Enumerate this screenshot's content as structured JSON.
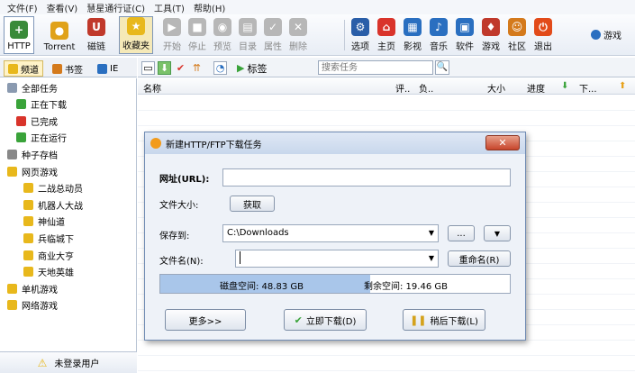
{
  "menu": [
    "文件(F)",
    "查看(V)",
    "慧星通行证(C)",
    "工具(T)",
    "帮助(H)"
  ],
  "toolbar": {
    "left": [
      {
        "label": "HTTP",
        "icon": "http-add-icon",
        "color": "#3a8a3a"
      },
      {
        "label": "Torrent",
        "icon": "torrent-icon",
        "color": "#e0a21a"
      },
      {
        "label": "磁链",
        "icon": "magnet-icon",
        "color": "#c0392b"
      },
      {
        "label": "收藏夹",
        "icon": "star-icon",
        "color": "#e8b81c"
      }
    ],
    "disabled": [
      {
        "label": "开始",
        "icon": "start-icon"
      },
      {
        "label": "停止",
        "icon": "stop-icon"
      },
      {
        "label": "预览",
        "icon": "preview-icon"
      },
      {
        "label": "目录",
        "icon": "folder-icon"
      },
      {
        "label": "属性",
        "icon": "properties-icon"
      },
      {
        "label": "删除",
        "icon": "delete-icon"
      }
    ],
    "right": [
      {
        "label": "选项",
        "icon": "options-icon",
        "color": "#2a5ea8"
      },
      {
        "label": "主页",
        "icon": "home-icon",
        "color": "#d9342b"
      },
      {
        "label": "影视",
        "icon": "video-icon",
        "color": "#2a6fc0"
      },
      {
        "label": "音乐",
        "icon": "music-icon",
        "color": "#2a6fc0"
      },
      {
        "label": "软件",
        "icon": "software-icon",
        "color": "#2a6fc0"
      },
      {
        "label": "游戏",
        "icon": "game-icon",
        "color": "#c0392b"
      },
      {
        "label": "社区",
        "icon": "community-icon",
        "color": "#d47a1c"
      },
      {
        "label": "退出",
        "icon": "exit-icon",
        "color": "#e24b1a"
      }
    ],
    "overflow": "游戏"
  },
  "tabs": [
    {
      "label": "频道",
      "icon": "channel-star-icon",
      "color": "#e8b81c"
    },
    {
      "label": "书签",
      "icon": "bookmark-icon",
      "color": "#d47a1c"
    },
    {
      "label": "IE",
      "icon": "ie-icon",
      "color": "#2a6fc0"
    }
  ],
  "subbar": {
    "tag_label": "标签",
    "search_placeholder": "搜索任务"
  },
  "tree": [
    {
      "label": "全部任务",
      "icon": "all-tasks-icon",
      "color": "#8a9ab0"
    },
    {
      "label": "正在下载",
      "icon": "downloading-icon",
      "color": "#3aa33a"
    },
    {
      "label": "已完成",
      "icon": "completed-icon",
      "color": "#d9342b"
    },
    {
      "label": "正在运行",
      "icon": "running-icon",
      "color": "#3aa33a"
    },
    {
      "label": "种子存档",
      "icon": "torrent-archive-icon",
      "color": "#888"
    },
    {
      "label": "网页游戏",
      "icon": "webgame-folder-icon",
      "color": "#e8b81c"
    },
    {
      "label": "二战总动员",
      "icon": "game-item-icon",
      "color": "#e8b81c"
    },
    {
      "label": "机器人大战",
      "icon": "game-item-icon",
      "color": "#e8b81c"
    },
    {
      "label": "神仙道",
      "icon": "game-item-icon",
      "color": "#e8b81c"
    },
    {
      "label": "兵临城下",
      "icon": "game-item-icon",
      "color": "#e8b81c"
    },
    {
      "label": "商业大亨",
      "icon": "game-item-icon",
      "color": "#e8b81c"
    },
    {
      "label": "天地英雄",
      "icon": "game-item-icon",
      "color": "#e8b81c"
    },
    {
      "label": "单机游戏",
      "icon": "single-game-folder-icon",
      "color": "#e8b81c"
    },
    {
      "label": "网络游戏",
      "icon": "online-game-folder-icon",
      "color": "#e8b81c"
    }
  ],
  "login_label": "未登录用户",
  "columns": [
    "名称",
    "评..",
    "负..",
    "大小",
    "进度",
    "下..."
  ],
  "dialog": {
    "title": "新建HTTP/FTP下载任务",
    "url_label": "网址(URL):",
    "url_value": "",
    "size_label": "文件大小:",
    "fetch_button": "获取",
    "save_label": "保存到:",
    "save_path": "C:\\Downloads",
    "browse_button": "...",
    "filename_label": "文件名(N):",
    "filename_value": "",
    "rename_button": "重命名(R)",
    "disk_space": "磁盘空间: 48.83 GB",
    "free_space": "剩余空间: 19.46 GB",
    "disk_used_fraction": 0.6,
    "more_button": "更多>>",
    "download_now_button": "立即下载(D)",
    "download_later_button": "稍后下载(L)"
  }
}
